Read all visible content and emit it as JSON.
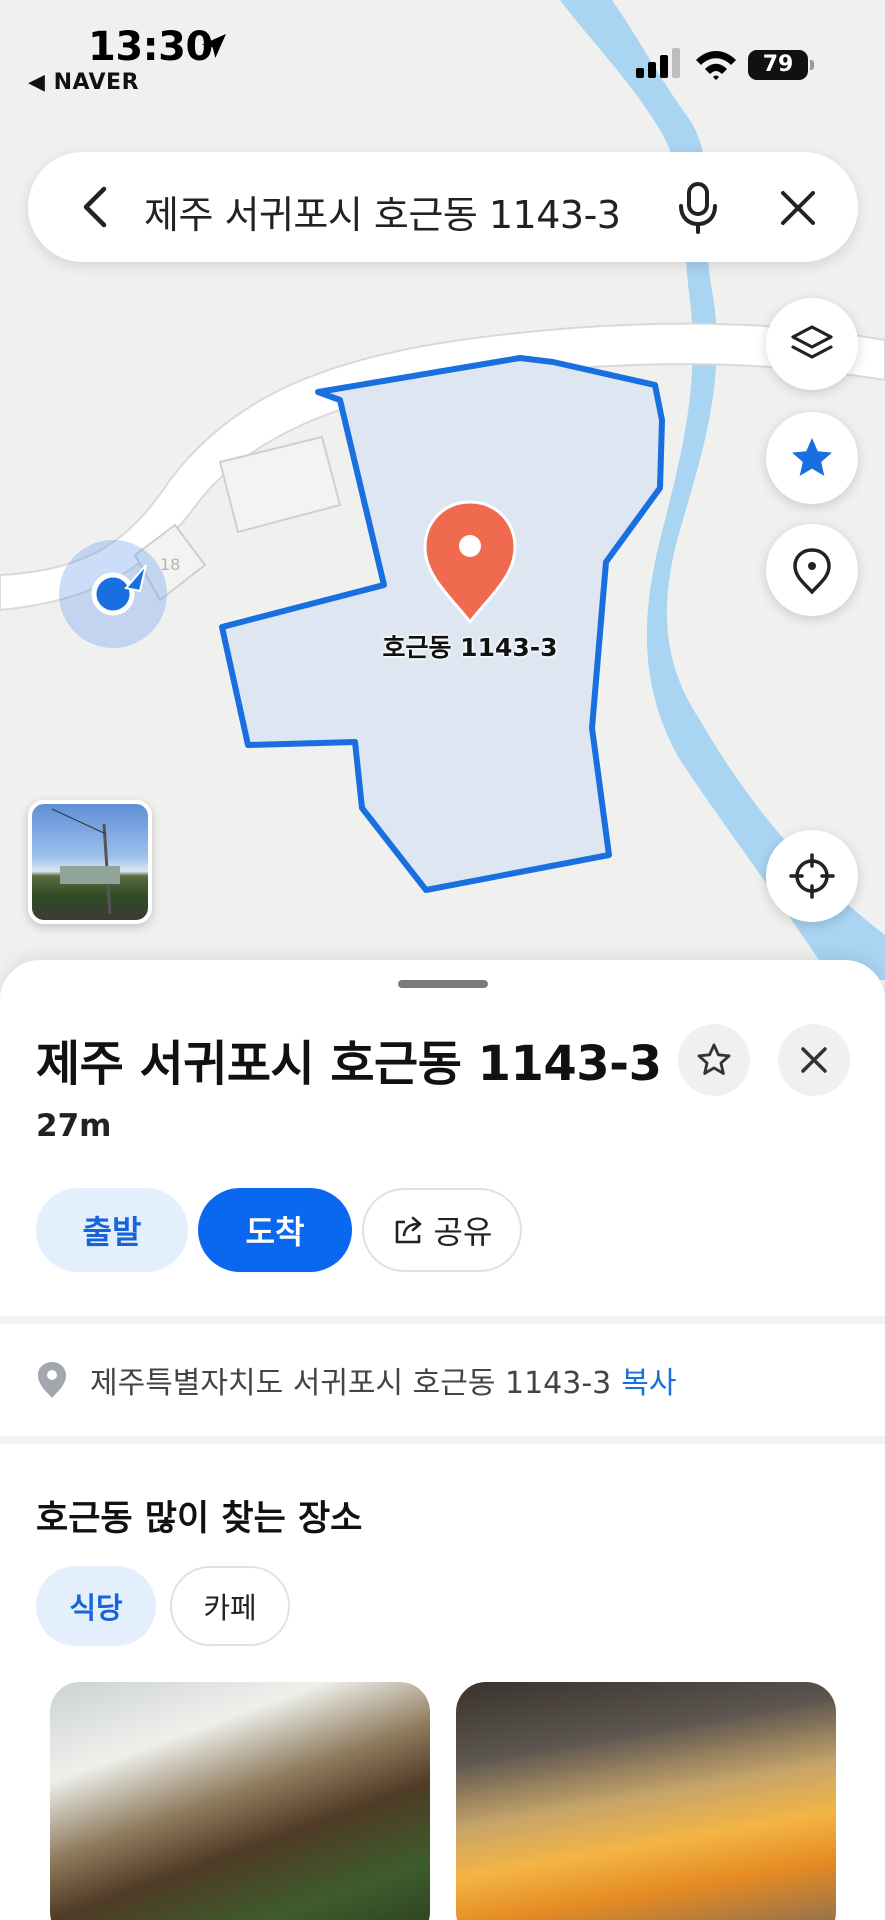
{
  "status_bar": {
    "time": "13:30",
    "back_app": "◀ NAVER",
    "battery": "79"
  },
  "search": {
    "query": "제주 서귀포시 호근동 1143-3"
  },
  "map": {
    "pin_label": "호근동 1143-3",
    "building_number": "18",
    "parcel_color": "#1a6fe0",
    "pin_color": "#f06a4f",
    "river_color": "#a9d4f2"
  },
  "sheet": {
    "title": "제주 서귀포시 호근동 1143-3",
    "distance": "27m",
    "start_label": "출발",
    "arrive_label": "도착",
    "share_label": "공유",
    "address": "제주특별자치도 서귀포시 호근동 1143-3",
    "copy_label": "복사",
    "section_title": "호근동 많이 찾는 장소",
    "chips": [
      "식당",
      "카페"
    ]
  },
  "accent_color": "#0a68f0"
}
